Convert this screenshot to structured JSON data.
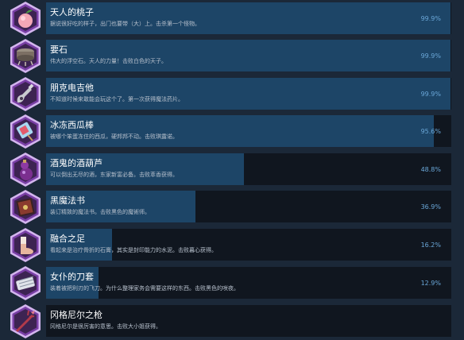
{
  "theme": {
    "background": "#1b2838",
    "track": "#10161f",
    "fill": "#1d4567",
    "percent_color": "#6aa7d8",
    "icon_frame_outer": "#d3b5ee",
    "icon_frame_inner": "#7a3fa6"
  },
  "achievements": [
    {
      "title": "天人的桃子",
      "description": "据说很好吃的样子，出门也要带（大）上。击杀第一个怪物。",
      "percent": "99.9%",
      "progress": 0.999,
      "icon": "peach-icon"
    },
    {
      "title": "要石",
      "description": "伟大的浮空石。天人的力量！击败白色的天子。",
      "percent": "99.9%",
      "progress": 0.999,
      "icon": "keystone-icon"
    },
    {
      "title": "朋克电吉他",
      "description": "不知道时候来敢能会玩这个了。第一次获得魔法药片。",
      "percent": "99.9%",
      "progress": 0.999,
      "icon": "guitar-icon"
    },
    {
      "title": "冰冻西瓜棒",
      "description": "被哪个笨蛋冻住的西瓜，硬邦邦不动。击败琪露诺。",
      "percent": "95.6%",
      "progress": 0.956,
      "icon": "ice-bar-icon"
    },
    {
      "title": "酒鬼的酒葫芦",
      "description": "可以倒出无尽的酒，东家新富必备。击败萃香获得。",
      "percent": "48.8%",
      "progress": 0.488,
      "icon": "gourd-icon"
    },
    {
      "title": "黑魔法书",
      "description": "装订精致的魔法书。击败黑色的魔術师。",
      "percent": "36.9%",
      "progress": 0.369,
      "icon": "spellbook-icon"
    },
    {
      "title": "融合之足",
      "description": "看起来是治疗骨折的石膏，其实是封印能力的水泥。击败暮心获得。",
      "percent": "16.2%",
      "progress": 0.162,
      "icon": "foot-icon"
    },
    {
      "title": "女仆的刀套",
      "description": "装着被把利刃的飞刀。为什么整理家务会需要这样的东西。击败黑色的咲夜。",
      "percent": "12.9%",
      "progress": 0.129,
      "icon": "knife-case-icon"
    },
    {
      "title": "冈格尼尔之枪",
      "description": "冈格尼尔是很厉害的意思。击败大小姐获得。",
      "percent": "",
      "progress": null,
      "icon": "spear-icon"
    }
  ]
}
